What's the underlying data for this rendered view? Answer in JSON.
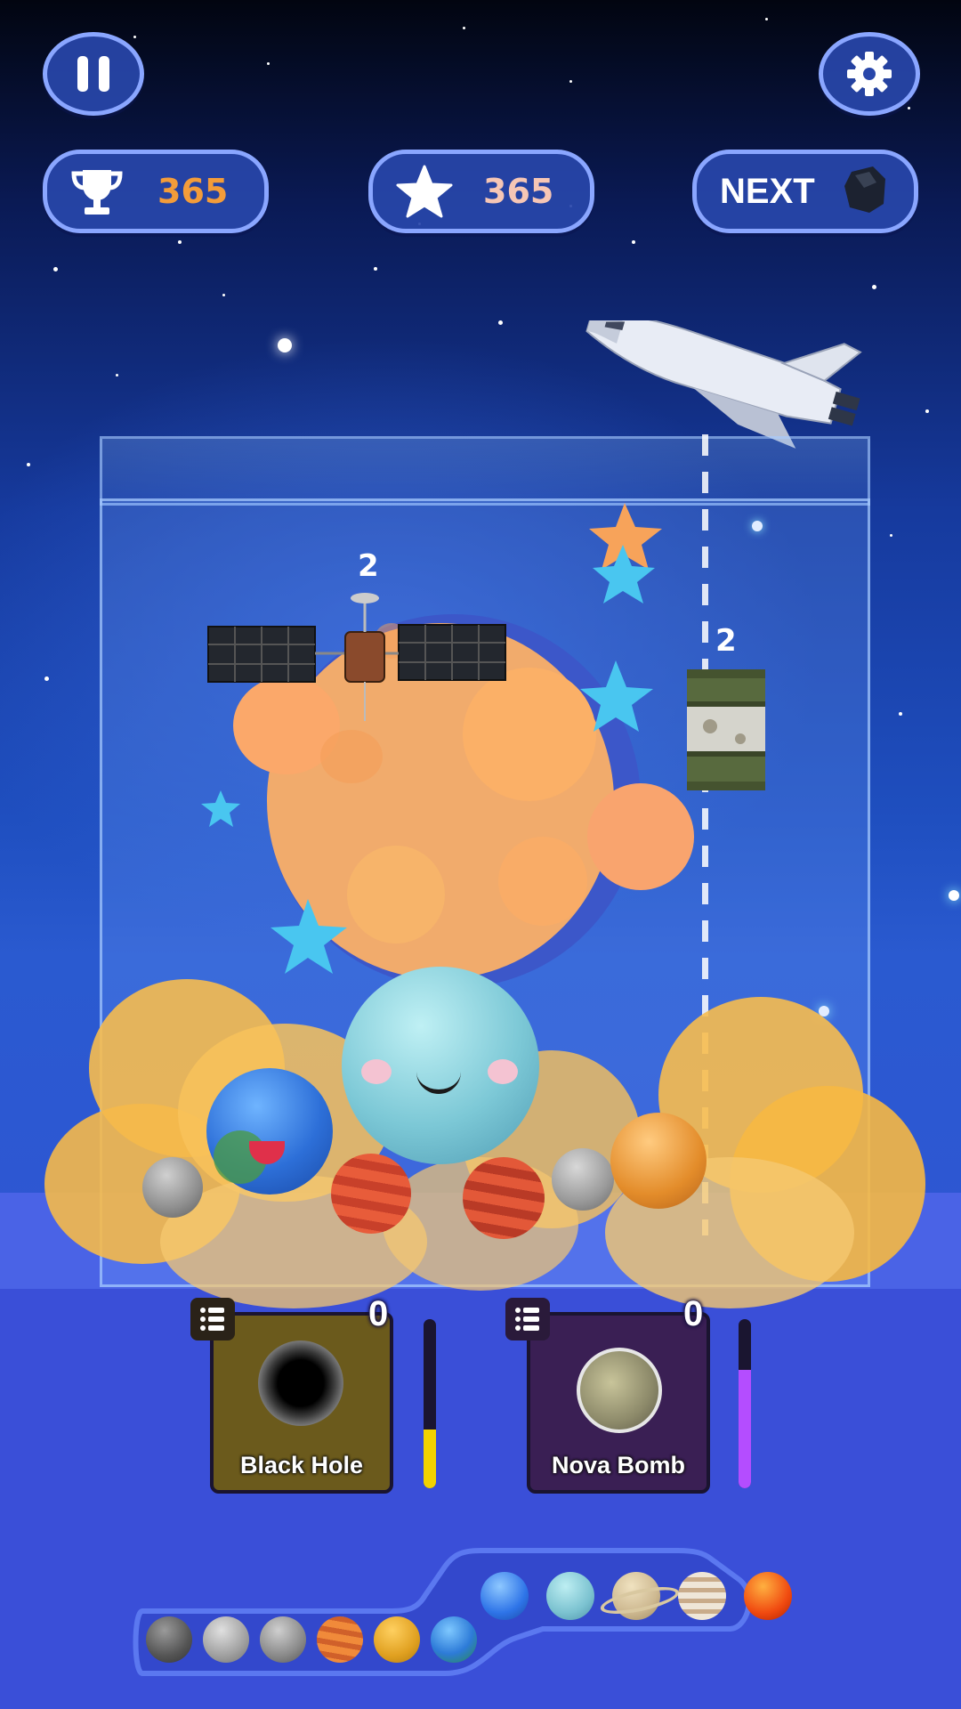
{
  "hud": {
    "pause_label": "pause",
    "settings_label": "settings",
    "best_score": "365",
    "current_score": "365",
    "next_label": "NEXT",
    "next_item_icon": "rock-icon"
  },
  "board": {
    "satellite_level": "2",
    "barrel_level": "2"
  },
  "powerups": [
    {
      "label": "Black Hole",
      "count": "0",
      "charge": 0.35,
      "color": "#f2d200"
    },
    {
      "label": "Nova Bomb",
      "count": "0",
      "charge": 0.7,
      "color": "#b44dff"
    }
  ],
  "evolution": {
    "planets": [
      "asteroid",
      "moon",
      "mercury",
      "mars",
      "venus",
      "earth",
      "neptune",
      "uranus",
      "saturn",
      "jupiter",
      "sun"
    ]
  },
  "colors": {
    "hud_fill": "#2846aa",
    "hud_border": "#8aa6ff",
    "best_score_color": "#f39c3a",
    "current_score_color": "#f6c6b5"
  }
}
